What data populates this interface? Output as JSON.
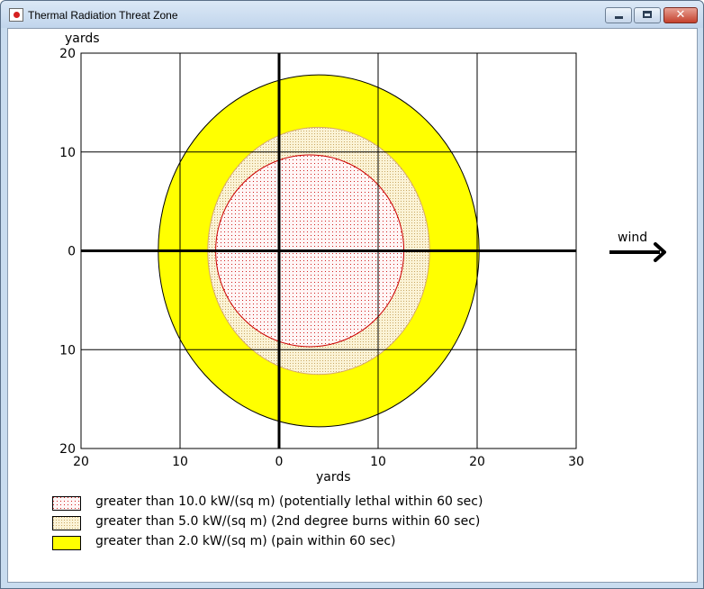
{
  "window": {
    "title": "Thermal Radiation Threat Zone",
    "controls": {
      "minimize": "minimize-icon",
      "maximize": "maximize-icon",
      "close": "close-icon"
    }
  },
  "chart_data": {
    "type": "area",
    "xlabel": "yards",
    "ylabel": "yards",
    "xlim": [
      -20,
      30
    ],
    "ylim": [
      -20,
      20
    ],
    "x_ticks": [
      -20,
      -10,
      0,
      10,
      20,
      30
    ],
    "x_tick_labels": [
      "20",
      "10",
      "0",
      "10",
      "20",
      "30"
    ],
    "y_ticks": [
      20,
      10,
      0,
      -10,
      -20
    ],
    "y_tick_labels": [
      "20",
      "10",
      "0",
      "10",
      "20"
    ],
    "grid": true,
    "legend_position": "bottom-left",
    "wind_label": "wind",
    "zones": [
      {
        "name": "greater than 2.0 kW/(sq m) (pain within 60 sec)",
        "fill": "#ffff00",
        "pattern": "solid",
        "stroke": "#000000",
        "center": [
          4.0,
          0.0
        ],
        "radius_x": 16.2,
        "radius_y": 17.8
      },
      {
        "name": "greater than 5.0 kW/(sq m) (2nd degree burns within 60 sec)",
        "fill": "#f4ecc6",
        "pattern": "dots",
        "stroke": "#d6a86a",
        "center": [
          4.0,
          0.0
        ],
        "radius_x": 11.2,
        "radius_y": 12.5
      },
      {
        "name": "greater than 10.0 kW/(sq m) (potentially lethal within 60 sec)",
        "fill": "#fdf0f0",
        "pattern": "red-dots",
        "stroke": "#cc0000",
        "center": [
          3.1,
          0.0
        ],
        "radius_x": 9.5,
        "radius_y": 9.7
      }
    ]
  },
  "legend": [
    {
      "text": "greater than 10.0 kW/(sq m) (potentially lethal within 60 sec)",
      "swatch": "red-dots"
    },
    {
      "text": "greater than 5.0 kW/(sq m) (2nd degree burns within 60 sec)",
      "swatch": "dots"
    },
    {
      "text": "greater than 2.0 kW/(sq m) (pain within 60 sec)",
      "swatch": "solid-yellow"
    }
  ]
}
